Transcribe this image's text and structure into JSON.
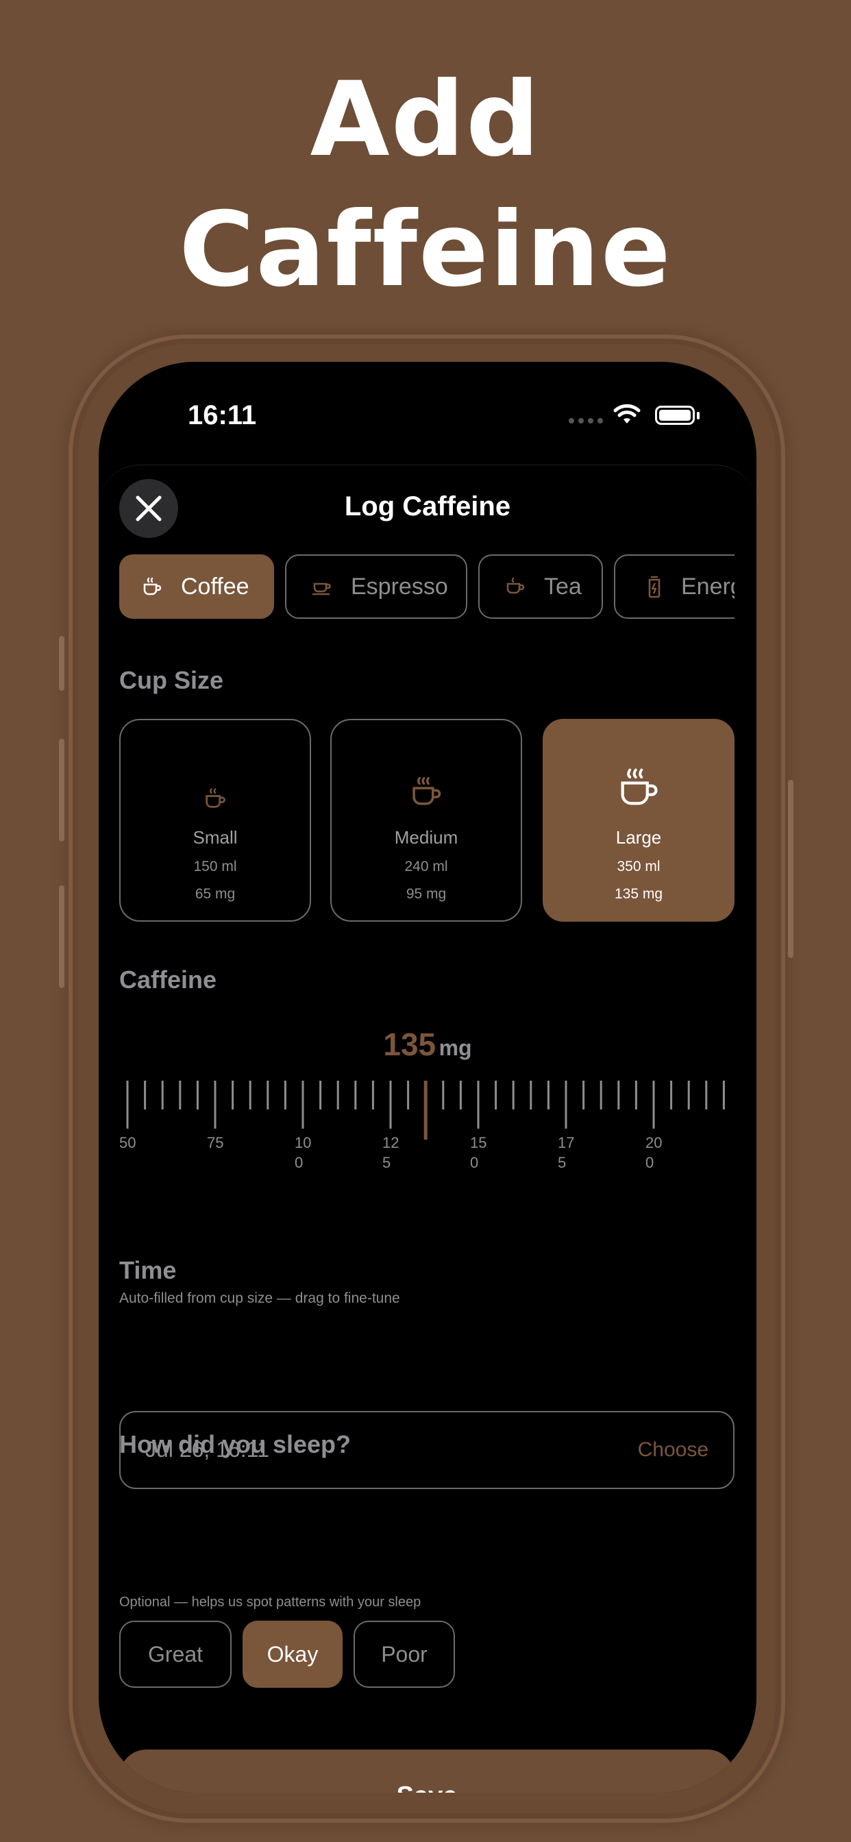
{
  "headline": {
    "line1": "Add",
    "line2": "Caffeine"
  },
  "status_bar": {
    "time": "16:11"
  },
  "sheet": {
    "title": "Log Caffeine"
  },
  "drink_types": [
    {
      "label": "Coffee",
      "icon": "coffee-cup-icon",
      "selected": true
    },
    {
      "label": "Espresso",
      "icon": "espresso-cup-icon",
      "selected": false
    },
    {
      "label": "Tea",
      "icon": "tea-cup-icon",
      "selected": false
    },
    {
      "label": "Energ",
      "icon": "energy-can-icon",
      "selected": false
    }
  ],
  "cup_size": {
    "label": "Cup Size",
    "options": [
      {
        "name": "Small",
        "volume": "150 ml",
        "caffeine": "65 mg",
        "selected": false
      },
      {
        "name": "Medium",
        "volume": "240 ml",
        "caffeine": "95 mg",
        "selected": false
      },
      {
        "name": "Large",
        "volume": "350 ml",
        "caffeine": "135 mg",
        "selected": true
      }
    ]
  },
  "caffeine": {
    "label": "Caffeine",
    "value": "135",
    "unit": "mg",
    "ruler_labels": [
      "50",
      "75",
      "10\n0",
      "12\n5",
      "15\n0",
      "17\n5",
      "20\n0"
    ],
    "hint": "Auto-filled from cup size — drag to fine-tune"
  },
  "time": {
    "label": "Time",
    "value": "Jul 26, 16:11",
    "action": "Choose"
  },
  "sleep": {
    "label": "How did you sleep?",
    "hint": "Optional — helps us spot patterns with your sleep",
    "options": [
      {
        "label": "Great",
        "selected": false
      },
      {
        "label": "Okay",
        "selected": true
      },
      {
        "label": "Poor",
        "selected": false
      }
    ]
  },
  "save_label": "Save",
  "colors": {
    "accent": "#7a563b",
    "background": "#6e4e37",
    "screen": "#000000",
    "muted_text": "#8e8e8e"
  }
}
